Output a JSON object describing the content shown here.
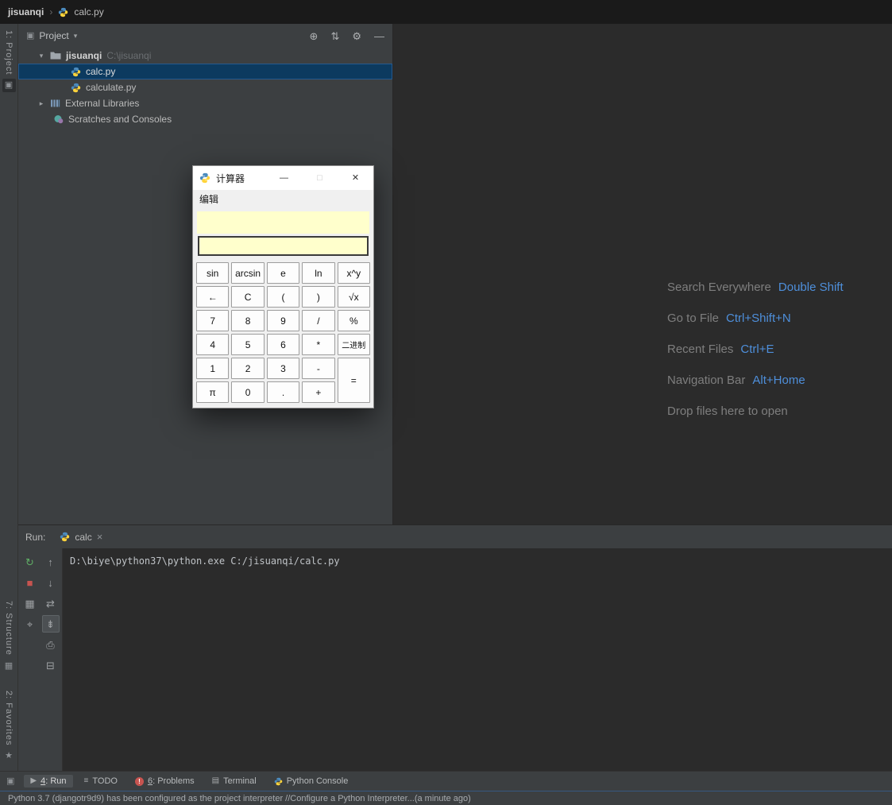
{
  "colors": {
    "accent_blue": "#4E8FDB",
    "selection_blue": "#0C3A5F",
    "run_green": "#5FAD65",
    "stop_red": "#C75450",
    "display_yellow": "#FFFFCC"
  },
  "titlebar": {
    "project": "jisuanqi",
    "separator": "›",
    "file": "calc.py"
  },
  "stripes": {
    "project": "1: Project",
    "structure": "7: Structure",
    "favorites": "2: Favorites"
  },
  "project_panel": {
    "title": "Project",
    "root": {
      "name": "jisuanqi",
      "path": "C:\\jisuanqi"
    },
    "items": {
      "calc": "calc.py",
      "calculate": "calculate.py",
      "external": "External Libraries",
      "scratches": "Scratches and Consoles"
    }
  },
  "editor": {
    "shortcuts": [
      {
        "action": "Search Everywhere",
        "keys": "Double Shift"
      },
      {
        "action": "Go to File",
        "keys": "Ctrl+Shift+N"
      },
      {
        "action": "Recent Files",
        "keys": "Ctrl+E"
      },
      {
        "action": "Navigation Bar",
        "keys": "Alt+Home"
      },
      {
        "action": "Drop files here to open",
        "keys": ""
      }
    ]
  },
  "calculator": {
    "title": "计算器",
    "menu": "编辑",
    "display1": "",
    "display2": "",
    "buttons": [
      [
        "sin",
        "arcsin",
        "e",
        "ln",
        "x^y"
      ],
      [
        "←",
        "C",
        "(",
        ")",
        "√x"
      ],
      [
        "7",
        "8",
        "9",
        "/",
        "%"
      ],
      [
        "4",
        "5",
        "6",
        "*",
        "二进制"
      ],
      [
        "1",
        "2",
        "3",
        "-",
        "="
      ],
      [
        "π",
        "0",
        ".",
        "+"
      ]
    ]
  },
  "run_panel": {
    "label": "Run:",
    "tab": "calc",
    "console_line": "D:\\biye\\python37\\python.exe C:/jisuanqi/calc.py"
  },
  "bottom_bar": {
    "items": [
      {
        "mnemonic": "4",
        "label": ": Run"
      },
      {
        "mnemonic": "",
        "label": "TODO"
      },
      {
        "mnemonic": "6",
        "label": ": Problems"
      },
      {
        "mnemonic": "",
        "label": "Terminal"
      },
      {
        "mnemonic": "",
        "label": "Python Console"
      }
    ]
  },
  "status_bar": {
    "message": "Python 3.7 (djangotr9d9) has been configured as the project interpreter // ",
    "link": "Configure a Python Interpreter...",
    "time": " (a minute ago)"
  }
}
